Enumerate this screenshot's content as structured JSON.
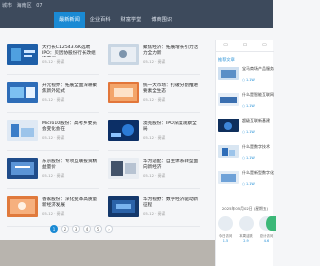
{
  "topbar": {
    "location": "城市",
    "city": "海南区",
    "region": "07"
  },
  "nav": [
    {
      "label": "最新新闻",
      "active": true
    },
    {
      "label": "企业百科",
      "active": false
    },
    {
      "label": "财富学堂",
      "active": false
    },
    {
      "label": "博商围识",
      "active": false
    }
  ],
  "articles": [
    {
      "title": "大行长C12543.6K选聘IPO：贝因协股份行长改组选聘议",
      "meta": "05-12  ·  阅读"
    },
    {
      "title": "聚焦经济：拓展增长引力活力全力新",
      "meta": "05-12  ·  阅读"
    },
    {
      "title": "开元视界：拓展全面深耕聚焦新外延式",
      "meta": "05-12  ·  阅读"
    },
    {
      "title": "统一大市场：打破分割推进要素全生态",
      "meta": "05-12  ·  阅读"
    },
    {
      "title": "Micro10股份：高考乡委员会变化会在",
      "meta": "05-12  ·  阅读"
    },
    {
      "title": "澳克股份：IPO深度观察全局",
      "meta": "05-12  ·  阅读"
    },
    {
      "title": "东京股份：专项互联投资精益量价",
      "meta": "05-12  ·  阅读"
    },
    {
      "title": "华为适配：自主体系转型面向新经济",
      "meta": "05-12  ·  阅读"
    },
    {
      "title": "香家股份：深化变革高质量新经济发展",
      "meta": "05-12  ·  阅读"
    },
    {
      "title": "华为视野：数字经济驱动新征程",
      "meta": "05-12  ·  阅读"
    }
  ],
  "pager": [
    "1",
    "2",
    "3",
    "4",
    "5",
    "›"
  ],
  "side": {
    "tabs": [
      "▭",
      "▭",
      "▭"
    ],
    "section_title": "推荐文章",
    "items": [
      {
        "title": "宝马商场产品服务",
        "meta": "○ 1.1W"
      },
      {
        "title": "什么是智能互联网",
        "meta": "○ 1.1W"
      },
      {
        "title": "超级互联新基建",
        "meta": "○ 1.1W"
      },
      {
        "title": "什么是数字技术",
        "meta": "○ 1.1W"
      },
      {
        "title": "什么是新型数字化",
        "meta": "○ 1.1W"
      }
    ],
    "date": "2025年05月02日 (星期五)",
    "stats_labels": [
      "今日访问",
      "本周活跃",
      "总计访问"
    ],
    "stats_values": [
      "1.5",
      "2.9",
      "4.6"
    ]
  },
  "colors": {
    "accent": "#1a8ad4",
    "topbar": "#3d4a5c",
    "green": "#3cb878"
  }
}
